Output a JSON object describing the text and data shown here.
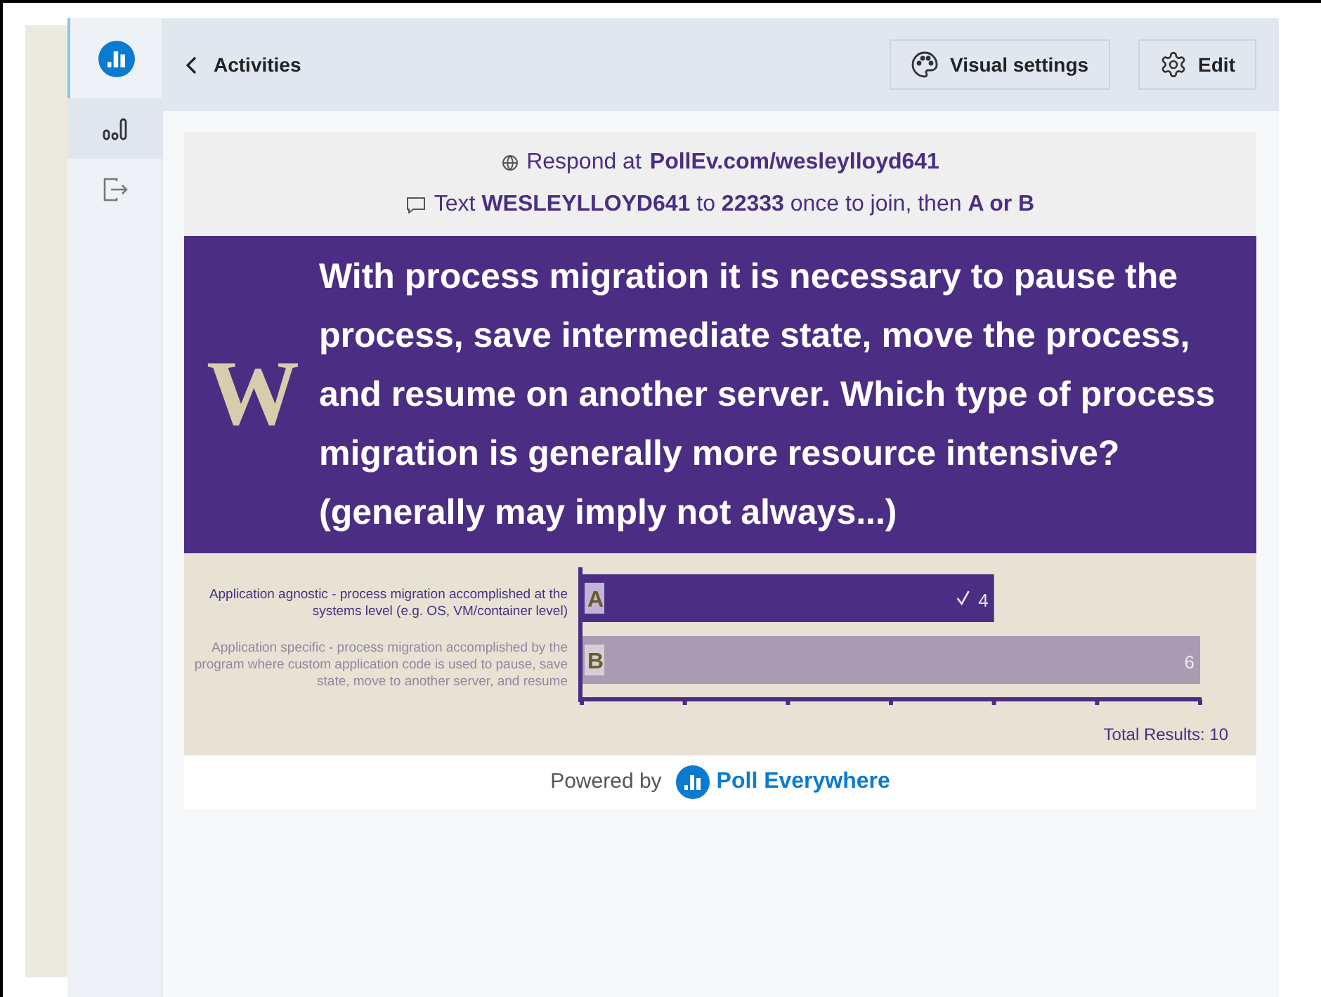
{
  "topbar": {
    "back_label": "Activities",
    "buttons": [
      {
        "kind": "palette",
        "label": "Visual settings"
      },
      {
        "kind": "gear",
        "label": "Edit"
      }
    ]
  },
  "sidebar": {
    "items": [
      {
        "kind": "results",
        "selected": true
      },
      {
        "kind": "exit",
        "selected": false
      }
    ]
  },
  "instructions": {
    "web_prefix": "Respond at",
    "web_url": "PollEv.com/wesleylloyd641",
    "sms": "Text **WESLEYLLOYD641** to **22333** once to join, then **A or B**"
  },
  "question": {
    "logo": "W",
    "text": "With process migration it is necessary to pause the process, save intermediate state, move the process, and resume on another server. Which type of process migration is generally more resource intensive? (generally may imply not always...)"
  },
  "options": [
    {
      "letter": "A",
      "correct": true
    },
    {
      "letter": "B",
      "correct": false
    }
  ],
  "chart_data": {
    "type": "bar",
    "orientation": "horizontal",
    "categories": [
      "Application agnostic - process migration accomplished at the systems level (e.g. OS, VM/container level)",
      "Application specific - process migration accomplished by the program where custom application code is used to pause, save state, move to another server, and resume"
    ],
    "values": [
      4,
      6
    ],
    "xlim": [
      0,
      6
    ],
    "data_labels": true
  },
  "total": "Total Results: 10",
  "footer": {
    "powered_by": "Powered by",
    "brand": "Poll Everywhere"
  }
}
